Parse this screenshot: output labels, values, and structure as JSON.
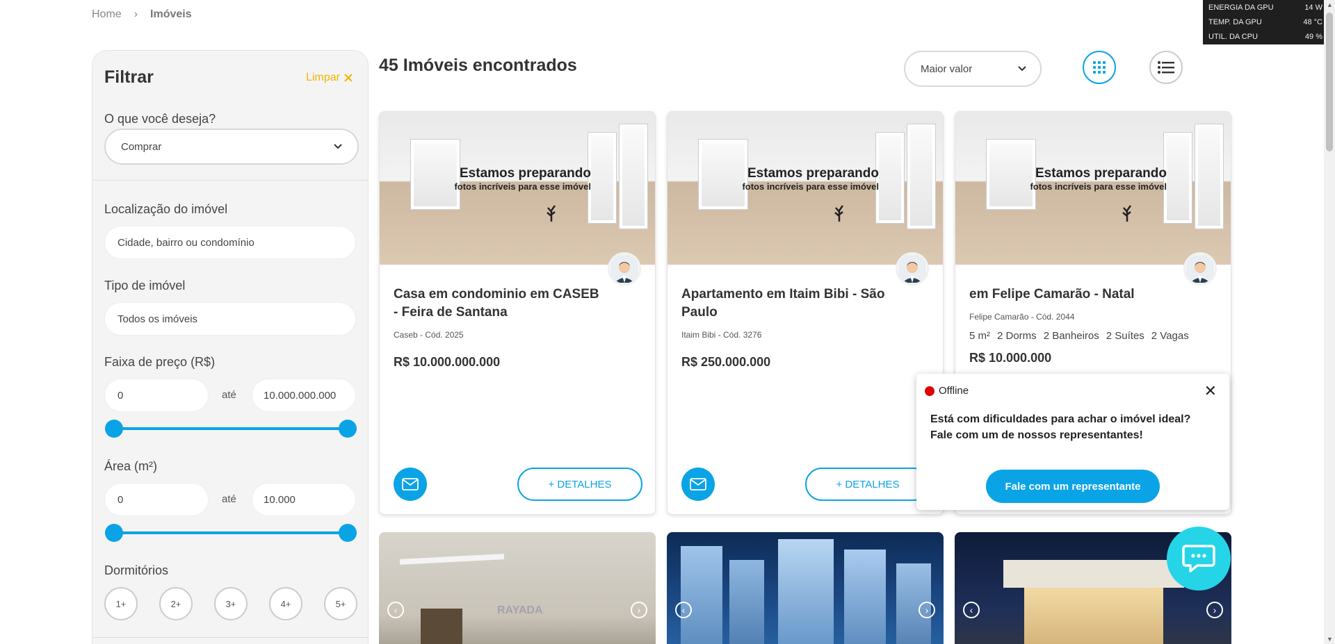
{
  "breadcrumb": {
    "home": "Home",
    "sep": "›",
    "current": "Imóveis"
  },
  "overlay": {
    "rows": [
      {
        "label": "ENERGIA DA GPU",
        "value": "14 W"
      },
      {
        "label": "TEMP. DA GPU",
        "value": "48 °C"
      },
      {
        "label": "UTIL. DA CPU",
        "value": "49 %"
      }
    ]
  },
  "filter": {
    "title": "Filtrar",
    "clear_label": "Limpar",
    "desire_label": "O que você deseja?",
    "desire_value": "Comprar",
    "location_label": "Localização do imóvel",
    "location_placeholder": "Cidade, bairro ou condomínio",
    "type_label": "Tipo de imóvel",
    "type_value": "Todos os imóveis",
    "price_label": "Faixa de preço (R$)",
    "price_min": "0",
    "price_max": "10.000.000.000",
    "between": "até",
    "area_label": "Área (m²)",
    "area_min": "0",
    "area_max": "10.000",
    "bedrooms_label": "Dormitórios",
    "bedrooms": [
      "1+",
      "2+",
      "3+",
      "4+",
      "5+"
    ]
  },
  "results": {
    "title": "45 Imóveis encontrados",
    "sort_value": "Maior valor"
  },
  "placeholder_img": {
    "line1": "Estamos preparando",
    "line2": "fotos incríveis para esse imóvel"
  },
  "cards": [
    {
      "title": "Casa em condominio em CASEB - Feira de Santana",
      "sub": "Caseb - Cód. 2025",
      "price": "R$ 10.000.000.000",
      "details": "+ DETALHES"
    },
    {
      "title": "Apartamento em Itaim Bibi - São Paulo",
      "sub": "Itaim Bibi - Cód. 3276",
      "price": "R$ 250.000.000",
      "details": "+ DETALHES"
    },
    {
      "title": "em Felipe Camarão - Natal",
      "sub": "Felipe Camarão - Cód. 2044",
      "features": [
        "5 m²",
        "2 Dorms",
        "2 Banheiros",
        "2 Suítes",
        "2 Vagas"
      ],
      "price": "R$ 10.000.000"
    }
  ],
  "watermark": "RAYADA",
  "chat": {
    "status": "Offline",
    "close": "✕",
    "message_line1": "Está com dificuldades para achar o imóvel ideal?",
    "message_line2": "Fale com um de nossos representantes!",
    "cta": "Fale com um representante"
  },
  "colors": {
    "accent": "#0aa4e6",
    "clear": "#f0b400",
    "offline": "#e00000",
    "chat_bubble": "#26d4e8"
  }
}
